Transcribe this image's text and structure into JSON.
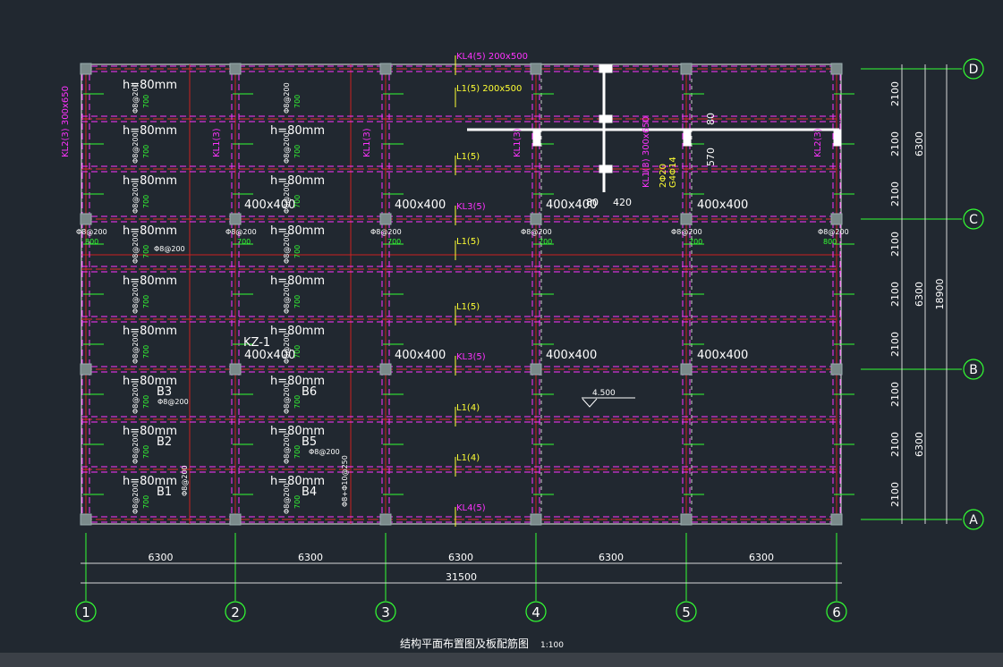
{
  "drawing": {
    "title": "结构平面布置图及板配筋图",
    "scale": "1:100"
  },
  "grid_labels": {
    "x": [
      "1",
      "2",
      "3",
      "4",
      "5",
      "6"
    ],
    "y": [
      "D",
      "C",
      "B",
      "A"
    ]
  },
  "dimensions": {
    "bay_widths": [
      "6300",
      "6300",
      "6300",
      "6300",
      "6300"
    ],
    "total_width": "31500",
    "right_sub": [
      "2100",
      "2100",
      "2100",
      "2100",
      "2100",
      "2100",
      "2100",
      "2100",
      "2100"
    ],
    "right_mid": [
      "6300",
      "6300",
      "6300"
    ],
    "right_total": "18900"
  },
  "beam_labels": {
    "kl4_top": "KL4(5) 200x500",
    "l1_top": "L1(5) 200x500",
    "kl2_left": "KL2(3) 300x650",
    "kl1": "KL1(3)",
    "kl2": "KL2(3)",
    "kl1_section": "KL1(3) 300x650",
    "kl1_rebar1": "2Φ20",
    "kl1_rebar2": "G4Φ14",
    "l1_5": "L1(5)",
    "kl3_5": "KL3(5)",
    "l1_4": "L1(4)",
    "kl4_bottom": "KL4(5)"
  },
  "slab_labels": {
    "h80": "h=80mm",
    "b1": "B1",
    "b2": "B2",
    "b3": "B3",
    "b4": "B4",
    "b5": "B5",
    "b6": "B6",
    "kz1": "KZ-1",
    "col400": "400x400"
  },
  "rebar_labels": {
    "phi8_200": "Φ8@200",
    "phi8_200b": "Φ8@200",
    "len800": "800",
    "len700": "700",
    "stirrup": "Φ8+Φ10@250",
    "w80": "80",
    "w570": "570",
    "w80b": "80",
    "w420": "420"
  },
  "elevation": "4.500"
}
